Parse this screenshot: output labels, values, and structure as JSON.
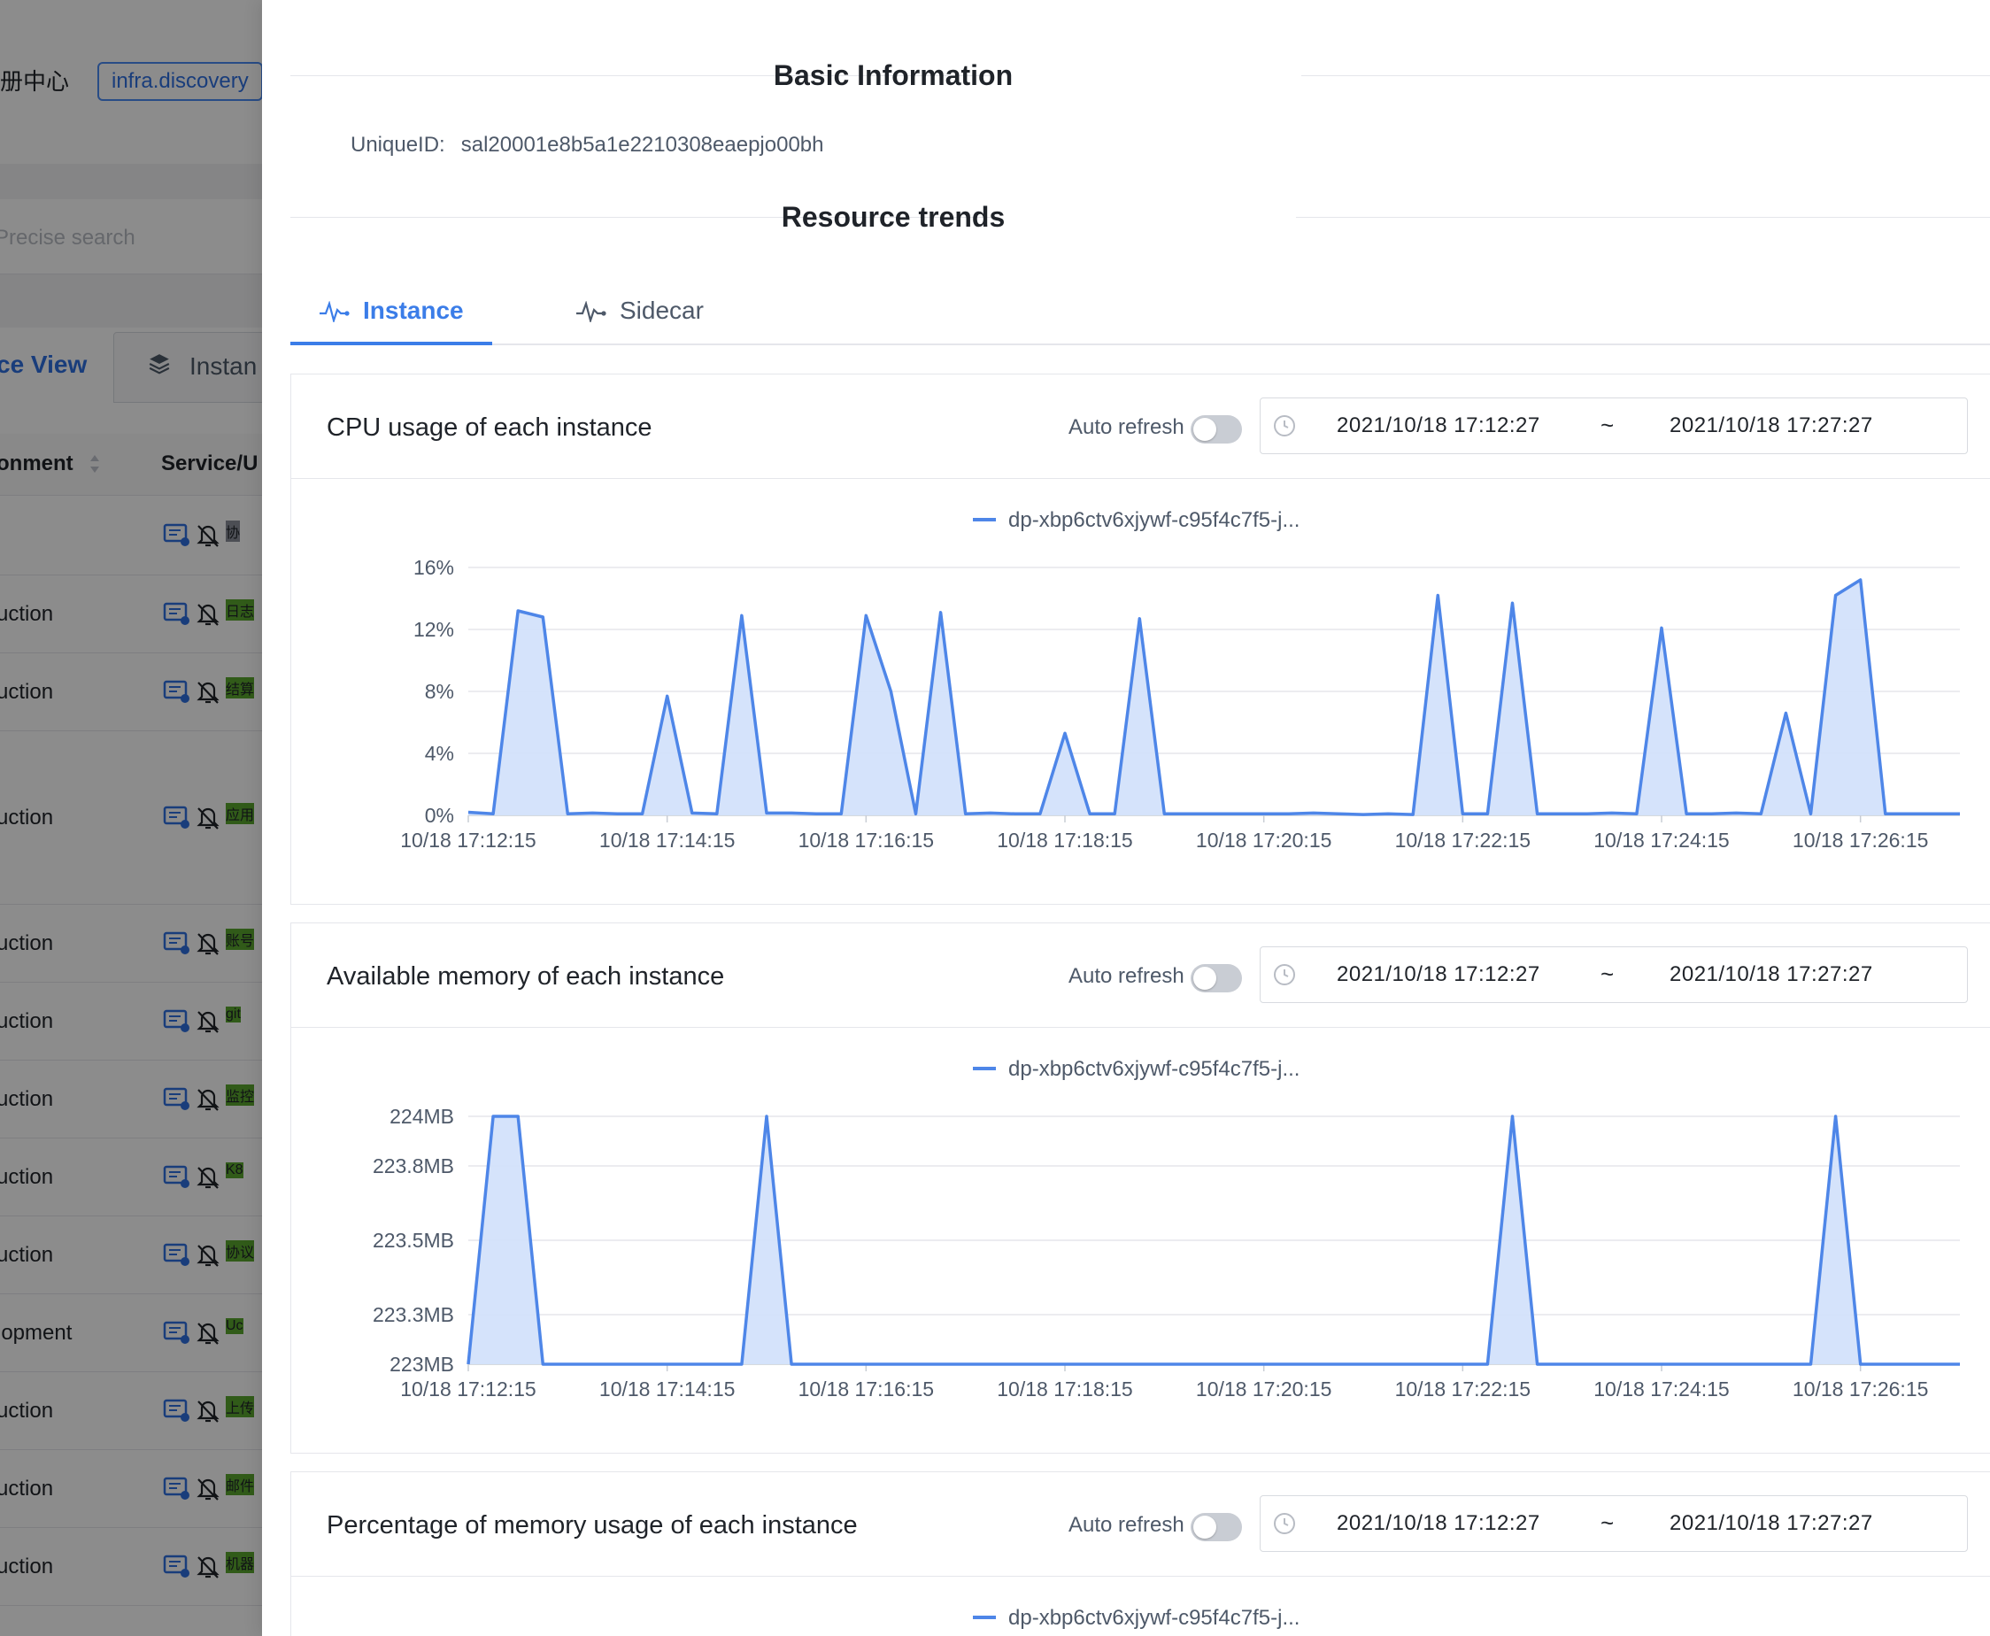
{
  "background": {
    "header_title": "册中心",
    "env_tag": "infra.discovery",
    "search_placeholder": "Precise search",
    "tabs": {
      "service_view": "ce View",
      "instance": "Instan"
    },
    "table_headers": {
      "environment": "onment",
      "service": "Service/U"
    },
    "rows": [
      {
        "env": "",
        "tag": "协",
        "tag_color": "#8a8f99"
      },
      {
        "env": "uction",
        "tag": "日志",
        "tag_color": "#5aa72f"
      },
      {
        "env": "uction",
        "tag": "结算",
        "tag_color": "#5aa72f"
      },
      {
        "env": "uction",
        "tag": "应用",
        "tag_color": "#5aa72f"
      },
      {
        "env": "uction",
        "tag": "账号",
        "tag_color": "#5aa72f"
      },
      {
        "env": "uction",
        "tag": "git",
        "tag_color": "#5aa72f"
      },
      {
        "env": "uction",
        "tag": "监控",
        "tag_color": "#5aa72f"
      },
      {
        "env": "uction",
        "tag": "K8",
        "tag_color": "#5aa72f"
      },
      {
        "env": "uction",
        "tag": "协议",
        "tag_color": "#5aa72f"
      },
      {
        "env": "lopment",
        "tag": "Uc",
        "tag_color": "#5aa72f"
      },
      {
        "env": "uction",
        "tag": "上传",
        "tag_color": "#5aa72f"
      },
      {
        "env": "uction",
        "tag": "邮件",
        "tag_color": "#5aa72f"
      },
      {
        "env": "uction",
        "tag": "机器",
        "tag_color": "#5aa72f"
      }
    ]
  },
  "drawer": {
    "basic_info_title": "Basic Information",
    "unique_id_label": "UniqueID:",
    "unique_id_value": "sal20001e8b5a1e2210308eaepjo00bh",
    "resource_trends_title": "Resource trends",
    "tabs": [
      {
        "label": "Instance",
        "active": true
      },
      {
        "label": "Sidecar",
        "active": false
      }
    ],
    "auto_refresh_label": "Auto refresh",
    "range_start": "2021/10/18 17:12:27",
    "range_separator": "~",
    "range_end": "2021/10/18 17:27:27"
  },
  "colors": {
    "accent": "#3b7de8",
    "series_line": "#4e86e8",
    "series_fill": "#d3e2fb"
  },
  "chart_data": [
    {
      "type": "area",
      "title": "CPU usage of each instance",
      "x_ticks": [
        "10/18 17:12:15",
        "10/18 17:14:15",
        "10/18 17:16:15",
        "10/18 17:18:15",
        "10/18 17:20:15",
        "10/18 17:22:15",
        "10/18 17:24:15",
        "10/18 17:26:15"
      ],
      "y_ticks": [
        "0%",
        "4%",
        "8%",
        "12%",
        "16%"
      ],
      "ylim": [
        0,
        16
      ],
      "y_tick_values": [
        0,
        4,
        8,
        12,
        16
      ],
      "series": [
        {
          "name": "dp-xbp6ctv6xjywf-c95f4c7f5-j...",
          "values": [
            0.2,
            0.1,
            13.2,
            12.8,
            0.1,
            0.15,
            0.1,
            0.1,
            7.7,
            0.15,
            0.1,
            12.9,
            0.15,
            0.15,
            0.1,
            0.1,
            12.9,
            8.0,
            0.1,
            13.1,
            0.1,
            0.15,
            0.1,
            0.1,
            5.3,
            0.1,
            0.1,
            12.7,
            0.1,
            0.1,
            0.1,
            0.1,
            0.1,
            0.1,
            0.15,
            0.1,
            0.05,
            0.1,
            0.05,
            14.2,
            0.1,
            0.1,
            13.7,
            0.1,
            0.1,
            0.1,
            0.15,
            0.1,
            12.1,
            0.1,
            0.1,
            0.15,
            0.1,
            6.6,
            0.1,
            14.2,
            15.2,
            0.1,
            0.1,
            0.1,
            0.1
          ]
        }
      ]
    },
    {
      "type": "area",
      "title": "Available memory of each instance",
      "x_ticks": [
        "10/18 17:12:15",
        "10/18 17:14:15",
        "10/18 17:16:15",
        "10/18 17:18:15",
        "10/18 17:20:15",
        "10/18 17:22:15",
        "10/18 17:24:15",
        "10/18 17:26:15"
      ],
      "y_ticks": [
        "223MB",
        "223.3MB",
        "223.5MB",
        "223.8MB",
        "224MB"
      ],
      "ylim": [
        223,
        224
      ],
      "y_tick_values": [
        223,
        223.2,
        223.5,
        223.8,
        224
      ],
      "series": [
        {
          "name": "dp-xbp6ctv6xjywf-c95f4c7f5-j...",
          "values": [
            223,
            224,
            224,
            223,
            223,
            223,
            223,
            223,
            223,
            223,
            223,
            223,
            224,
            223,
            223,
            223,
            223,
            223,
            223,
            223,
            223,
            223,
            223,
            223,
            223,
            223,
            223,
            223,
            223,
            223,
            223,
            223,
            223,
            223,
            223,
            223,
            223,
            223,
            223,
            223,
            223,
            223,
            224,
            223,
            223,
            223,
            223,
            223,
            223,
            223,
            223,
            223,
            223,
            223,
            223,
            224,
            223,
            223,
            223,
            223,
            223
          ]
        }
      ]
    },
    {
      "type": "area",
      "title": "Percentage of memory usage of each instance",
      "series": [
        {
          "name": "dp-xbp6ctv6xjywf-c95f4c7f5-j..."
        }
      ]
    }
  ]
}
